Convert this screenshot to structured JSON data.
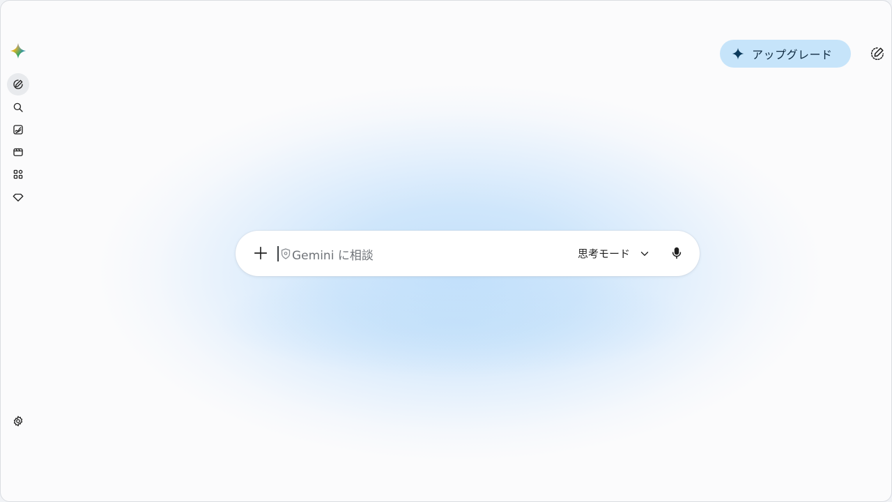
{
  "colors": {
    "accent_bg": "#c6e4fa",
    "icon": "#1f1f1f",
    "placeholder": "#6f7378"
  },
  "sidebar": {
    "logo_icon": "gemini-sparkle-icon",
    "items": [
      {
        "icon": "new-chat-icon",
        "active": true
      },
      {
        "icon": "search-icon",
        "active": false
      },
      {
        "icon": "gallery-icon",
        "active": false
      },
      {
        "icon": "video-icon",
        "active": false
      },
      {
        "icon": "apps-icon",
        "active": false
      },
      {
        "icon": "gem-icon",
        "active": false
      }
    ],
    "settings_icon": "gear-icon"
  },
  "header": {
    "upgrade_label": "アップグレード",
    "upgrade_icon": "sparkle-icon",
    "new_chat_icon": "new-chat-icon"
  },
  "prompt": {
    "placeholder": "Gemini に相談",
    "mode_label": "思考モード",
    "add_icon": "plus-icon",
    "mode_icon": "chevron-down-icon",
    "mic_icon": "microphone-icon"
  }
}
